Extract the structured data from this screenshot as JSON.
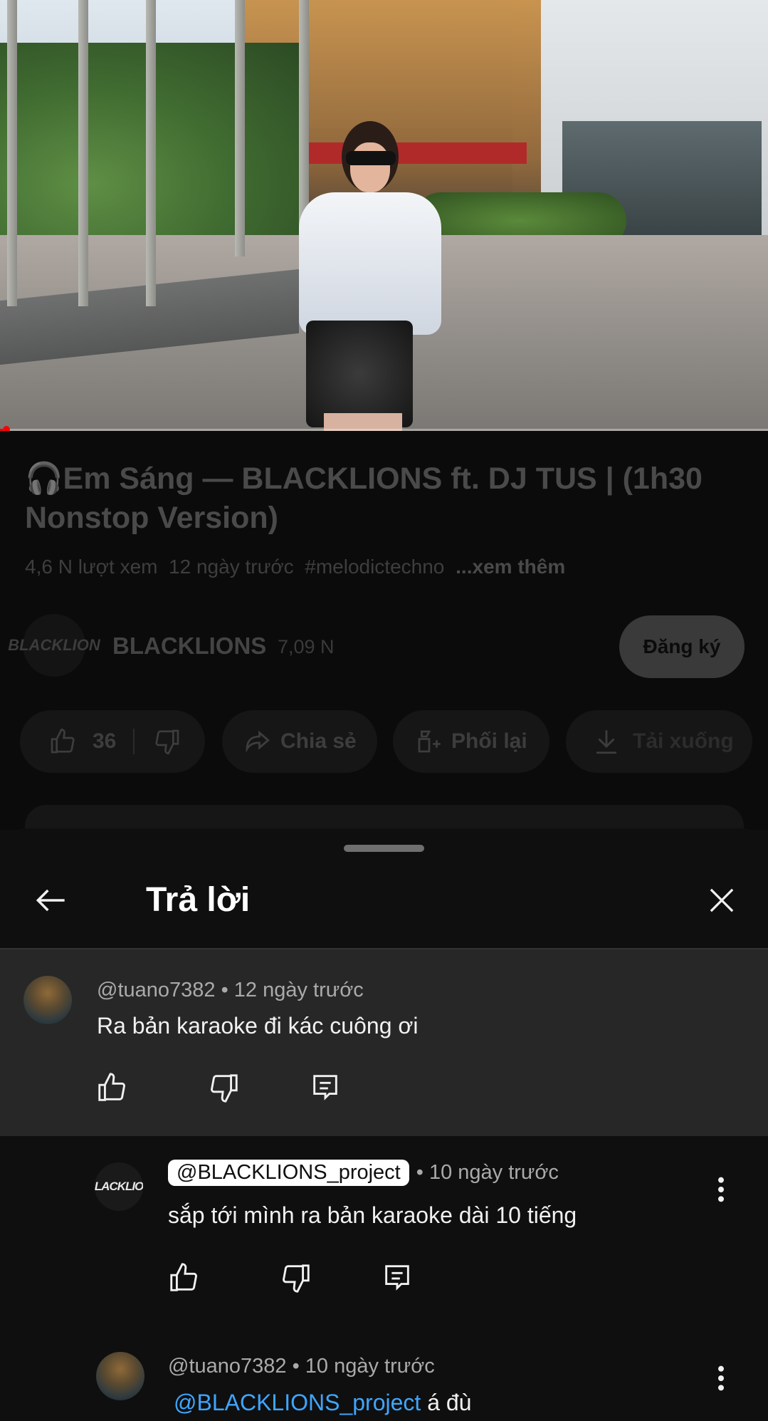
{
  "video": {
    "progress_fraction": 0.004
  },
  "info": {
    "title_icon": "headphones-icon",
    "title": "🎧Em Sáng — BLACKLIONS ft. DJ TUS | (1h30 Nonstop Version)",
    "views": "4,6 N lượt xem",
    "age": "12 ngày trước",
    "hashtag": "#melodictechno",
    "more": "...xem thêm"
  },
  "channel": {
    "avatar_text": "BLACKLION",
    "name": "BLACKLIONS",
    "subs": "7,09 N",
    "subscribe_label": "Đăng ký"
  },
  "actions": {
    "like_count": "36",
    "share": "Chia sẻ",
    "remix": "Phối lại",
    "download": "Tải xuống"
  },
  "sheet": {
    "title": "Trả lời"
  },
  "comments": [
    {
      "author": "@tuano7382",
      "time": "• 12 ngày trước",
      "text": "Ra bản karaoke đi kác cuông ơi"
    },
    {
      "author": "@BLACKLIONS_project",
      "time": "• 10 ngày trước",
      "text": "sắp tới mình ra bản karaoke dài 10 tiếng",
      "avatar_text": "BLACKLION"
    },
    {
      "author": "@tuano7382",
      "time": "• 10 ngày trước",
      "mention": "@BLACKLIONS_project",
      "text": " á đù"
    }
  ],
  "colors": {
    "background": "#0f0f0f",
    "highlight_comment": "#272727",
    "mention": "#3ea6ff",
    "progress": "#ff0000"
  }
}
